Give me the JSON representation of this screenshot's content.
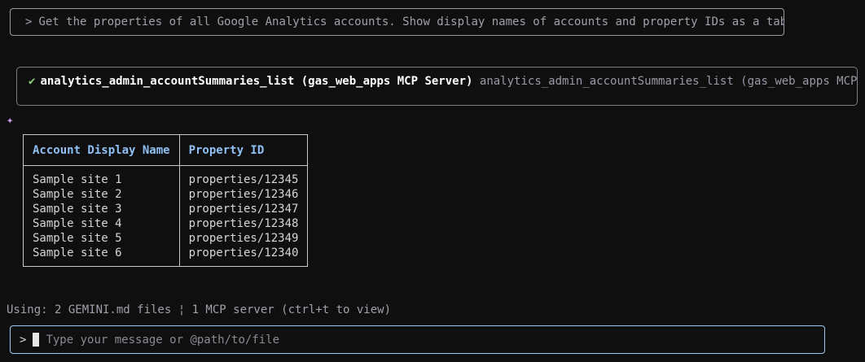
{
  "prompt": {
    "marker": ">",
    "text": "Get the properties of all Google Analytics accounts. Show display names of accounts and property IDs as a table."
  },
  "tool_call": {
    "status_icon": "✔",
    "name": "analytics_admin_accountSummaries_list (gas_web_apps MCP Server)",
    "description": "analytics_admin_accountSummaries_list (gas_web_apps MCP Se…"
  },
  "response_icon": "✦",
  "table": {
    "headers": [
      "Account Display Name",
      "Property ID"
    ],
    "rows": [
      [
        "Sample site 1",
        "properties/12345"
      ],
      [
        "Sample site 2",
        "properties/12346"
      ],
      [
        "Sample site 3",
        "properties/12347"
      ],
      [
        "Sample site 4",
        "properties/12348"
      ],
      [
        "Sample site 5",
        "properties/12349"
      ],
      [
        "Sample site 6",
        "properties/12340"
      ]
    ]
  },
  "status_line": "Using: 2 GEMINI.md files ¦ 1 MCP server (ctrl+t to view)",
  "input": {
    "marker": ">",
    "placeholder": "Type your message or @path/to/file"
  },
  "colors": {
    "background": "#0f0f10",
    "header_text": "#8fc0f4",
    "check": "#8ed47a",
    "sparkle": "#c89cf0",
    "input_border": "#9ec8f0"
  }
}
